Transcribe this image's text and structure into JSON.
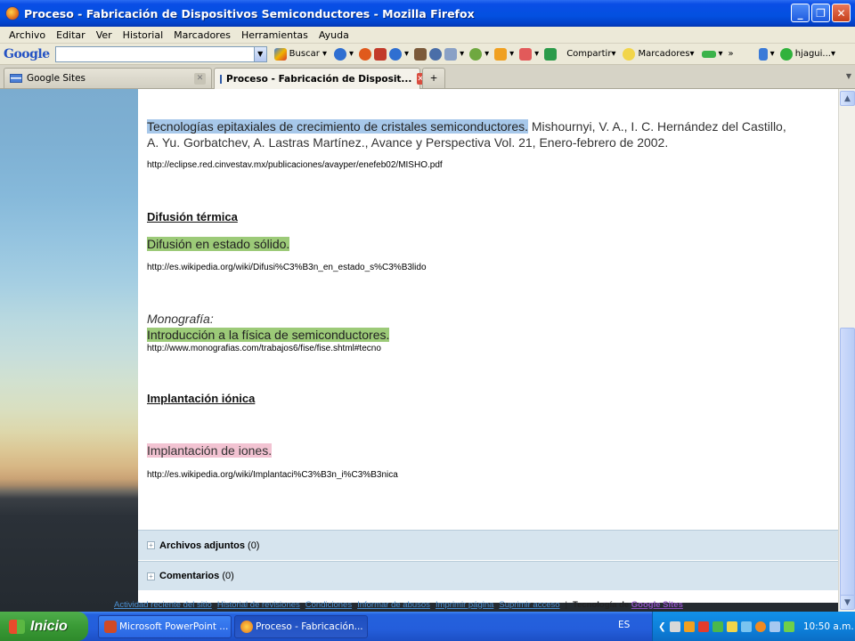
{
  "window": {
    "title": "Proceso - Fabricación de Dispositivos Semiconductores - Mozilla Firefox"
  },
  "menu": [
    "Archivo",
    "Editar",
    "Ver",
    "Historial",
    "Marcadores",
    "Herramientas",
    "Ayuda"
  ],
  "google_toolbar": {
    "logo": "Google",
    "search_value": "",
    "buscar": "Buscar",
    "compartir": "Compartir",
    "marcadores": "Marcadores",
    "more": "»",
    "user": "hjagui..."
  },
  "tabs": [
    {
      "label": "Google Sites",
      "active": false
    },
    {
      "label": "Proceso - Fabricación de Disposit...",
      "active": true
    }
  ],
  "content": {
    "ref1_link": "Tecnologías epitaxiales de crecimiento de cristales semiconductores.",
    "ref1_rest": " Mishournyi, V. A., I. C. Hernández del Castillo,",
    "ref1_line2": "A. Yu. Gorbatchev, A. Lastras Martínez., Avance y Perspectiva Vol. 21, Enero-febrero de 2002.",
    "ref1_url": "http://eclipse.red.cinvestav.mx/publicaciones/avayper/enefeb02/MISHO.pdf",
    "heading_difusion": "Difusión térmica",
    "ref2_link": "Difusión en estado sólido.",
    "ref2_url": "http://es.wikipedia.org/wiki/Difusi%C3%B3n_en_estado_s%C3%B3lido",
    "monografia": "Monografía:",
    "ref3_link": "Introducción a la física de semiconductores.",
    "ref3_url": "http://www.monografias.com/trabajos6/fise/fise.shtml#tecno",
    "heading_implantacion": "Implantación iónica",
    "ref4_link": "Implantación de iones.",
    "ref4_url": "http://es.wikipedia.org/wiki/Implantaci%C3%B3n_i%C3%B3nica"
  },
  "attachments": {
    "label": "Archivos adjuntos",
    "count": "(0)"
  },
  "comments": {
    "label": "Comentarios",
    "count": "(0)"
  },
  "footer": {
    "links": [
      "Actividad reciente del sitio",
      "Historial de revisiones",
      "Condiciones",
      "Informar de abusos",
      "Imprimir página",
      "Suprimir acceso"
    ],
    "separator": "|",
    "tech_prefix": "Tecnología de",
    "tech_brand": "Google Sites"
  },
  "taskbar": {
    "start": "Inicio",
    "buttons": [
      "Microsoft PowerPoint ...",
      "Proceso - Fabricación..."
    ],
    "lang": "ES",
    "clock": "10:50 a.m."
  }
}
